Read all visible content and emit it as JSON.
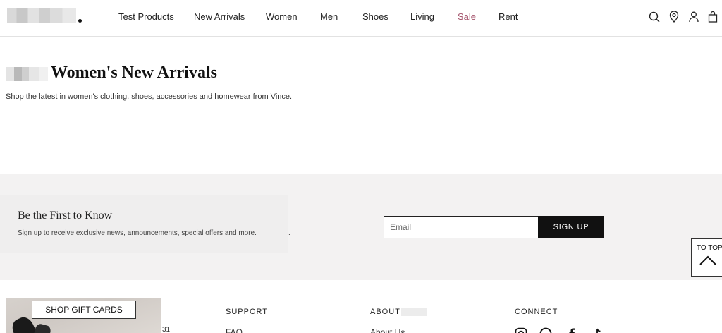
{
  "nav": {
    "items": [
      {
        "label": "Test Products"
      },
      {
        "label": "New Arrivals"
      },
      {
        "label": "Women"
      },
      {
        "label": "Men"
      },
      {
        "label": "Shoes"
      },
      {
        "label": "Living"
      },
      {
        "label": "Sale"
      },
      {
        "label": "Rent"
      }
    ],
    "icons": [
      "search-icon",
      "location-pin-icon",
      "account-icon",
      "shopping-bag-icon"
    ]
  },
  "hero": {
    "title": "Women's New Arrivals",
    "subtitle": "Shop the latest in women's clothing, shoes, accessories and homewear from Vince."
  },
  "newsletter": {
    "title": "Be the First to Know",
    "subtitle": "Sign up to receive exclusive news, announcements, special offers and more.",
    "trailing": ".",
    "email_placeholder": "Email",
    "signup_label": "SIGN UP"
  },
  "to_top": {
    "label": "TO TOP"
  },
  "footer": {
    "gift_cards_label": "SHOP GIFT CARDS",
    "gift_extra": "31",
    "support": {
      "heading": "SUPPORT",
      "first_link": "FAQ"
    },
    "about": {
      "heading": "ABOUT",
      "first_link": "About Us"
    },
    "connect": {
      "heading": "CONNECT",
      "icons": [
        "instagram-icon",
        "pinterest-icon",
        "facebook-icon",
        "tiktok-icon"
      ]
    }
  },
  "colors": {
    "accent_sale": "#a4536b",
    "band_bg": "#f3f2f2",
    "button_bg": "#111111"
  }
}
